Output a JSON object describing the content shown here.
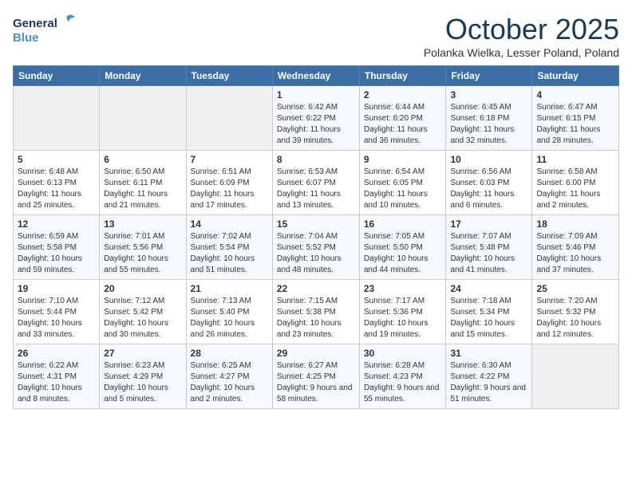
{
  "header": {
    "logo_general": "General",
    "logo_blue": "Blue",
    "month_title": "October 2025",
    "location": "Polanka Wielka, Lesser Poland, Poland"
  },
  "days_of_week": [
    "Sunday",
    "Monday",
    "Tuesday",
    "Wednesday",
    "Thursday",
    "Friday",
    "Saturday"
  ],
  "weeks": [
    [
      {
        "day": "",
        "sunrise": "",
        "sunset": "",
        "daylight": ""
      },
      {
        "day": "",
        "sunrise": "",
        "sunset": "",
        "daylight": ""
      },
      {
        "day": "",
        "sunrise": "",
        "sunset": "",
        "daylight": ""
      },
      {
        "day": "1",
        "sunrise": "Sunrise: 6:42 AM",
        "sunset": "Sunset: 6:22 PM",
        "daylight": "Daylight: 11 hours and 39 minutes."
      },
      {
        "day": "2",
        "sunrise": "Sunrise: 6:44 AM",
        "sunset": "Sunset: 6:20 PM",
        "daylight": "Daylight: 11 hours and 36 minutes."
      },
      {
        "day": "3",
        "sunrise": "Sunrise: 6:45 AM",
        "sunset": "Sunset: 6:18 PM",
        "daylight": "Daylight: 11 hours and 32 minutes."
      },
      {
        "day": "4",
        "sunrise": "Sunrise: 6:47 AM",
        "sunset": "Sunset: 6:15 PM",
        "daylight": "Daylight: 11 hours and 28 minutes."
      }
    ],
    [
      {
        "day": "5",
        "sunrise": "Sunrise: 6:48 AM",
        "sunset": "Sunset: 6:13 PM",
        "daylight": "Daylight: 11 hours and 25 minutes."
      },
      {
        "day": "6",
        "sunrise": "Sunrise: 6:50 AM",
        "sunset": "Sunset: 6:11 PM",
        "daylight": "Daylight: 11 hours and 21 minutes."
      },
      {
        "day": "7",
        "sunrise": "Sunrise: 6:51 AM",
        "sunset": "Sunset: 6:09 PM",
        "daylight": "Daylight: 11 hours and 17 minutes."
      },
      {
        "day": "8",
        "sunrise": "Sunrise: 6:53 AM",
        "sunset": "Sunset: 6:07 PM",
        "daylight": "Daylight: 11 hours and 13 minutes."
      },
      {
        "day": "9",
        "sunrise": "Sunrise: 6:54 AM",
        "sunset": "Sunset: 6:05 PM",
        "daylight": "Daylight: 11 hours and 10 minutes."
      },
      {
        "day": "10",
        "sunrise": "Sunrise: 6:56 AM",
        "sunset": "Sunset: 6:03 PM",
        "daylight": "Daylight: 11 hours and 6 minutes."
      },
      {
        "day": "11",
        "sunrise": "Sunrise: 6:58 AM",
        "sunset": "Sunset: 6:00 PM",
        "daylight": "Daylight: 11 hours and 2 minutes."
      }
    ],
    [
      {
        "day": "12",
        "sunrise": "Sunrise: 6:59 AM",
        "sunset": "Sunset: 5:58 PM",
        "daylight": "Daylight: 10 hours and 59 minutes."
      },
      {
        "day": "13",
        "sunrise": "Sunrise: 7:01 AM",
        "sunset": "Sunset: 5:56 PM",
        "daylight": "Daylight: 10 hours and 55 minutes."
      },
      {
        "day": "14",
        "sunrise": "Sunrise: 7:02 AM",
        "sunset": "Sunset: 5:54 PM",
        "daylight": "Daylight: 10 hours and 51 minutes."
      },
      {
        "day": "15",
        "sunrise": "Sunrise: 7:04 AM",
        "sunset": "Sunset: 5:52 PM",
        "daylight": "Daylight: 10 hours and 48 minutes."
      },
      {
        "day": "16",
        "sunrise": "Sunrise: 7:05 AM",
        "sunset": "Sunset: 5:50 PM",
        "daylight": "Daylight: 10 hours and 44 minutes."
      },
      {
        "day": "17",
        "sunrise": "Sunrise: 7:07 AM",
        "sunset": "Sunset: 5:48 PM",
        "daylight": "Daylight: 10 hours and 41 minutes."
      },
      {
        "day": "18",
        "sunrise": "Sunrise: 7:09 AM",
        "sunset": "Sunset: 5:46 PM",
        "daylight": "Daylight: 10 hours and 37 minutes."
      }
    ],
    [
      {
        "day": "19",
        "sunrise": "Sunrise: 7:10 AM",
        "sunset": "Sunset: 5:44 PM",
        "daylight": "Daylight: 10 hours and 33 minutes."
      },
      {
        "day": "20",
        "sunrise": "Sunrise: 7:12 AM",
        "sunset": "Sunset: 5:42 PM",
        "daylight": "Daylight: 10 hours and 30 minutes."
      },
      {
        "day": "21",
        "sunrise": "Sunrise: 7:13 AM",
        "sunset": "Sunset: 5:40 PM",
        "daylight": "Daylight: 10 hours and 26 minutes."
      },
      {
        "day": "22",
        "sunrise": "Sunrise: 7:15 AM",
        "sunset": "Sunset: 5:38 PM",
        "daylight": "Daylight: 10 hours and 23 minutes."
      },
      {
        "day": "23",
        "sunrise": "Sunrise: 7:17 AM",
        "sunset": "Sunset: 5:36 PM",
        "daylight": "Daylight: 10 hours and 19 minutes."
      },
      {
        "day": "24",
        "sunrise": "Sunrise: 7:18 AM",
        "sunset": "Sunset: 5:34 PM",
        "daylight": "Daylight: 10 hours and 15 minutes."
      },
      {
        "day": "25",
        "sunrise": "Sunrise: 7:20 AM",
        "sunset": "Sunset: 5:32 PM",
        "daylight": "Daylight: 10 hours and 12 minutes."
      }
    ],
    [
      {
        "day": "26",
        "sunrise": "Sunrise: 6:22 AM",
        "sunset": "Sunset: 4:31 PM",
        "daylight": "Daylight: 10 hours and 8 minutes."
      },
      {
        "day": "27",
        "sunrise": "Sunrise: 6:23 AM",
        "sunset": "Sunset: 4:29 PM",
        "daylight": "Daylight: 10 hours and 5 minutes."
      },
      {
        "day": "28",
        "sunrise": "Sunrise: 6:25 AM",
        "sunset": "Sunset: 4:27 PM",
        "daylight": "Daylight: 10 hours and 2 minutes."
      },
      {
        "day": "29",
        "sunrise": "Sunrise: 6:27 AM",
        "sunset": "Sunset: 4:25 PM",
        "daylight": "Daylight: 9 hours and 58 minutes."
      },
      {
        "day": "30",
        "sunrise": "Sunrise: 6:28 AM",
        "sunset": "Sunset: 4:23 PM",
        "daylight": "Daylight: 9 hours and 55 minutes."
      },
      {
        "day": "31",
        "sunrise": "Sunrise: 6:30 AM",
        "sunset": "Sunset: 4:22 PM",
        "daylight": "Daylight: 9 hours and 51 minutes."
      },
      {
        "day": "",
        "sunrise": "",
        "sunset": "",
        "daylight": ""
      }
    ]
  ]
}
